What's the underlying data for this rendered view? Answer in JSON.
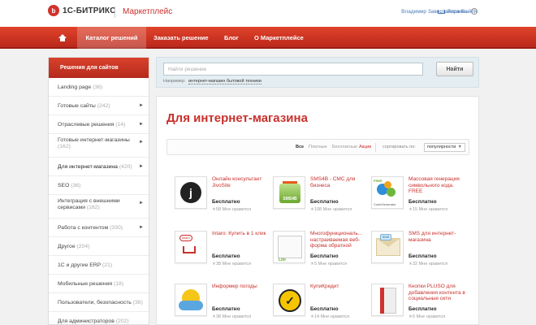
{
  "header": {
    "logo_mark": "b",
    "logo_text": "1С-БИТРИКС",
    "marketplace": "Маркетплейс",
    "user": "Владимир Завертайлов",
    "logout": "Выйти",
    "cart": "Корзина",
    "help": "?"
  },
  "nav": {
    "items": [
      "Каталог решений",
      "Заказать решение",
      "Блог",
      "О Маркетплейсе"
    ]
  },
  "sidebar": {
    "title": "Решения для сайтов",
    "items": [
      {
        "label": "Landing page",
        "count": "(36)",
        "arrow": ""
      },
      {
        "label": "Готовые сайты",
        "count": "(242)",
        "arrow": "►"
      },
      {
        "label": "Отраслевые решения",
        "count": "(14)",
        "arrow": "►"
      },
      {
        "label": "Готовые интернет-магазины",
        "count": "(162)",
        "arrow": "►"
      },
      {
        "label": "Для интернет-магазина",
        "count": "(420)",
        "arrow": "►"
      },
      {
        "label": "SEO",
        "count": "(36)",
        "arrow": ""
      },
      {
        "label": "Интеграция с внешними сервисами",
        "count": "(162)",
        "arrow": "►"
      },
      {
        "label": "Работа с контентом",
        "count": "(330)",
        "arrow": "►"
      },
      {
        "label": "Другое",
        "count": "(204)",
        "arrow": ""
      },
      {
        "label": "1С и другие ERP",
        "count": "(21)",
        "arrow": ""
      },
      {
        "label": "Мобильные решения",
        "count": "(18)",
        "arrow": ""
      },
      {
        "label": "Пользователи, безопасность",
        "count": "(36)",
        "arrow": ""
      },
      {
        "label": "Для администраторов",
        "count": "(202)",
        "arrow": ""
      }
    ]
  },
  "search": {
    "placeholder": "Найти решение",
    "button": "Найти",
    "example_label": "Например:",
    "example_link": "интернет-магазин бытовой техники"
  },
  "main": {
    "title": "Для интернет-магазина",
    "filters": [
      "Все",
      "Платные",
      "Бесплатные",
      "Акции"
    ],
    "sort_label": "сортировать по:",
    "sort_value": "популярности",
    "dropdown": "▼"
  },
  "cards": [
    {
      "name": "Онлайн консультант JivoSite",
      "price": "Бесплатно",
      "likes": "58",
      "like_text": "Мне нравится",
      "icon": "jivosite-icon",
      "thumb_text": "j"
    },
    {
      "name": "SMS4B - СМС для бизнеса",
      "price": "Бесплатно",
      "likes": "108",
      "like_text": "Мне нравится",
      "icon": "sms-envelope-icon",
      "thumb_text": "SMS4B"
    },
    {
      "name": "Массовая генерация символьного кода. FREE",
      "price": "Бесплатно",
      "likes": "15",
      "like_text": "Мне нравится",
      "icon": "gears-icon",
      "thumb_text": "CodeGenerator",
      "badge": "FREE"
    },
    {
      "name": "Intaro: Купить в 1 клик",
      "price": "Бесплатно",
      "likes": "38",
      "like_text": "Мне нравится",
      "icon": "cart-icon",
      "thumb_text": "intaro"
    },
    {
      "name": "Многофункциональ... настраиваемая веб-форма обратной",
      "price": "Бесплатно",
      "likes": "5",
      "like_text": "Мне нравится",
      "icon": "form-icon",
      "thumb_text": "Lite"
    },
    {
      "name": "SMS для интернет-магазина",
      "price": "Бесплатно",
      "likes": "32",
      "like_text": "Мне нравится",
      "icon": "envelope-icon",
      "thumb_text": "SMS"
    },
    {
      "name": "Информер погоды",
      "price": "Бесплатно",
      "likes": "38",
      "like_text": "Мне нравится",
      "icon": "weather-icon"
    },
    {
      "name": "КупиКредит",
      "price": "Бесплатно",
      "likes": "14",
      "like_text": "Мне нравится",
      "icon": "check-icon",
      "thumb_text": "✓"
    },
    {
      "name": "Кнопки PLUSO для добавления контента в социальные сети",
      "price": "Бесплатно",
      "likes": "5",
      "like_text": "Мне нравится",
      "icon": "pluso-box-icon"
    }
  ]
}
